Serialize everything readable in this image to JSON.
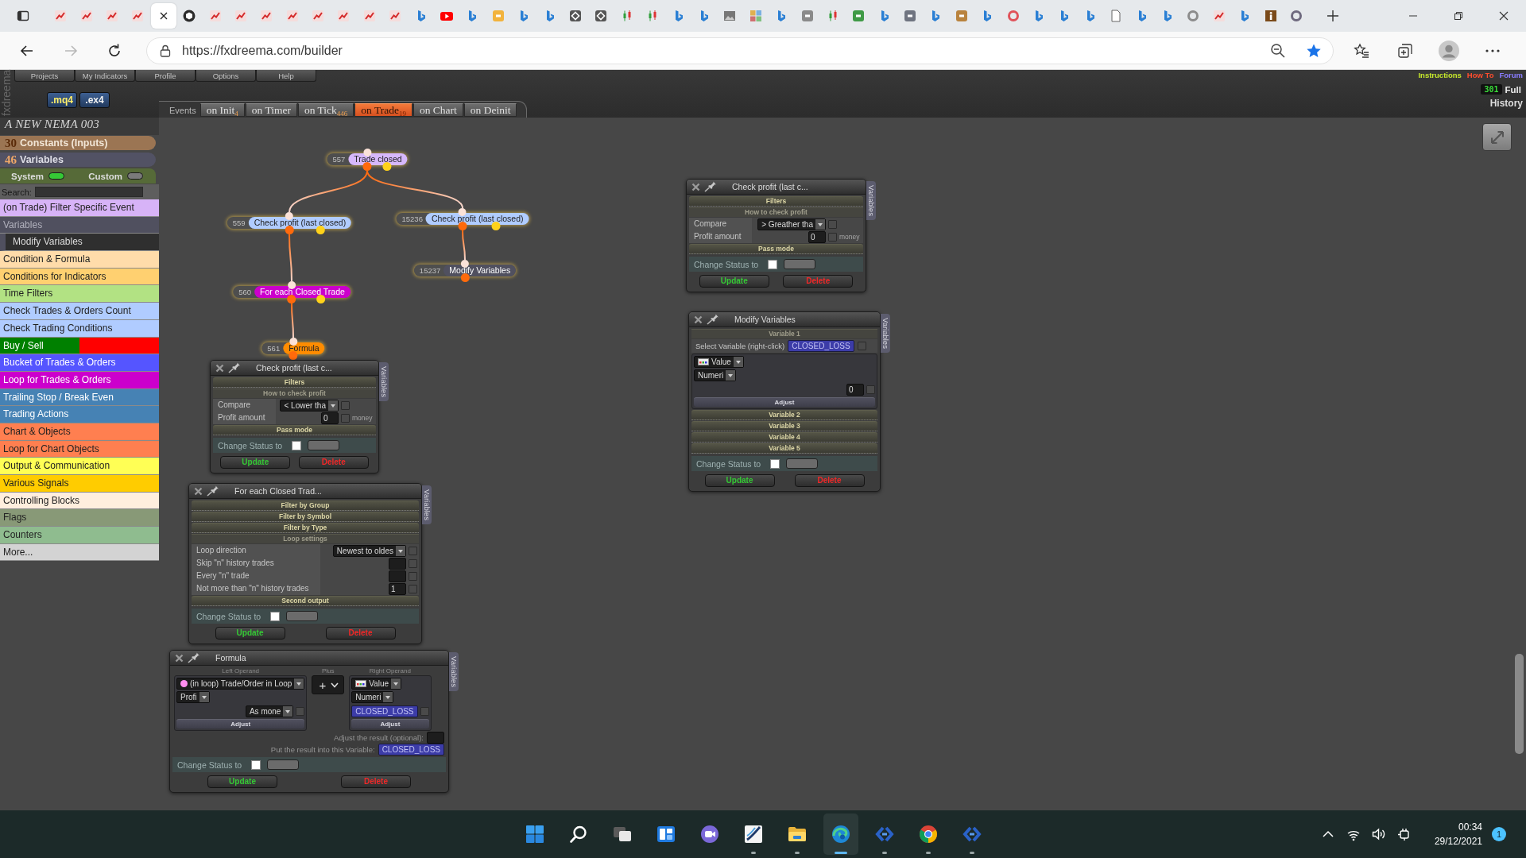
{
  "browser": {
    "tabs": [
      {
        "kind": "pen",
        "selected": false
      },
      {
        "kind": "pen",
        "selected": false
      },
      {
        "kind": "pen",
        "selected": false
      },
      {
        "kind": "pen",
        "selected": false
      },
      {
        "selected": true
      },
      {
        "kind": "hexagon",
        "selected": false
      },
      {
        "kind": "pen",
        "selected": false
      },
      {
        "kind": "pen",
        "selected": false
      },
      {
        "kind": "pen",
        "selected": false
      },
      {
        "kind": "pen",
        "selected": false
      },
      {
        "kind": "pen",
        "selected": false
      },
      {
        "kind": "pen",
        "selected": false
      },
      {
        "kind": "pen",
        "selected": false
      },
      {
        "kind": "pen",
        "selected": false
      },
      {
        "kind": "ribbon",
        "selected": false
      },
      {
        "kind": "play",
        "selected": false
      },
      {
        "kind": "ribbon",
        "selected": false
      },
      {
        "kind": "square",
        "color": "#f2b33d",
        "selected": false
      },
      {
        "kind": "ribbon",
        "selected": false
      },
      {
        "kind": "ribbon",
        "selected": false
      },
      {
        "kind": "diamond",
        "selected": false
      },
      {
        "kind": "diamond",
        "selected": false
      },
      {
        "kind": "candles",
        "selected": false
      },
      {
        "kind": "candles",
        "selected": false
      },
      {
        "kind": "ribbon",
        "selected": false
      },
      {
        "kind": "ribbon",
        "selected": false
      },
      {
        "kind": "picture",
        "selected": false
      },
      {
        "kind": "mosaic",
        "selected": false
      },
      {
        "kind": "ribbon",
        "selected": false
      },
      {
        "kind": "square",
        "color": "#8a8a8a",
        "selected": false
      },
      {
        "kind": "candles",
        "selected": false
      },
      {
        "kind": "square",
        "color": "#3f9a46",
        "selected": false
      },
      {
        "kind": "ribbon",
        "selected": false
      },
      {
        "kind": "square",
        "color": "#6f7480",
        "selected": false
      },
      {
        "kind": "ribbon",
        "selected": false
      },
      {
        "kind": "square",
        "color": "#b9833e",
        "selected": false
      },
      {
        "kind": "ribbon",
        "selected": false
      },
      {
        "kind": "ring",
        "color": "#e0525a",
        "selected": false
      },
      {
        "kind": "ribbon",
        "selected": false
      },
      {
        "kind": "ribbon",
        "selected": false
      },
      {
        "kind": "ribbon",
        "selected": false
      },
      {
        "kind": "page",
        "selected": false
      },
      {
        "kind": "ribbon",
        "selected": false
      },
      {
        "kind": "ribbon",
        "selected": false
      },
      {
        "kind": "ring",
        "color": "#8c8c8c",
        "selected": false
      },
      {
        "kind": "pen",
        "selected": false
      },
      {
        "kind": "ribbon",
        "selected": false
      },
      {
        "kind": "info",
        "selected": false
      },
      {
        "kind": "ring",
        "color": "#6f6a7f",
        "selected": false
      }
    ],
    "nav": [
      {
        "kind": "back",
        "disabled": false
      },
      {
        "kind": "forward",
        "disabled": true
      },
      {
        "kind": "refresh",
        "disabled": false
      }
    ],
    "address": {
      "url": "https://fxdreema.com/builder",
      "bookmarked": true
    }
  },
  "app": {
    "side_label": "fxdreema",
    "menu": [
      "Projects",
      "My Indicators",
      "Profile",
      "Options",
      "Help"
    ],
    "exports": [
      {
        "label": ".mq4",
        "selected": true
      },
      {
        "label": ".ex4",
        "selected": false
      }
    ],
    "links": [
      {
        "label": "Instructions",
        "color": "#c6e82c"
      },
      {
        "label": "How To",
        "color": "#ff4d2e"
      },
      {
        "label": "Forum",
        "color": "#8a7dff"
      }
    ],
    "counter": "301",
    "full": "Full",
    "history": "History"
  },
  "events": {
    "label": "Events",
    "tabs": [
      {
        "label": "on Init$_{4}$",
        "selected": false
      },
      {
        "label": "on Timer",
        "selected": false
      },
      {
        "label": "on Tick$_{446}$",
        "selected": false
      },
      {
        "label": "on Trade$_{19}$",
        "selected": true
      },
      {
        "label": "on Chart",
        "selected": false
      },
      {
        "label": "on Deinit",
        "selected": false
      }
    ]
  },
  "sidebar": {
    "project": "A NEW NEMA 003",
    "constants": {
      "count": "30",
      "label": "Constants (Inputs)"
    },
    "variables": {
      "count": "46",
      "label": "Variables"
    },
    "toggles": [
      {
        "label": "System",
        "on": true
      },
      {
        "label": "Custom",
        "on": false
      }
    ],
    "search_label": "Search:",
    "categories": [
      {
        "kind": "item",
        "label": "(on Trade) Filter Specific Event",
        "color": "#d7b3f7"
      },
      {
        "kind": "header",
        "label": "Variables"
      },
      {
        "kind": "subitem",
        "label": "Modify Variables"
      },
      {
        "kind": "item",
        "label": "Condition & Formula",
        "color": "#ffdcaa"
      },
      {
        "kind": "item",
        "label": "Conditions for Indicators",
        "color": "#ffd070"
      },
      {
        "kind": "item",
        "label": "Time Filters",
        "color": "#b2e283"
      },
      {
        "kind": "item",
        "label": "Check Trades & Orders Count",
        "color": "#b0ccff"
      },
      {
        "kind": "item",
        "label": "Check Trading Conditions",
        "color": "#b0ccff"
      },
      {
        "kind": "split",
        "label": "Buy / Sell",
        "color": "#008000",
        "bands": [
          {
            "color": "#ff0000"
          }
        ]
      },
      {
        "kind": "item",
        "label": "Bucket of Trades & Orders",
        "color": "#5555ff"
      },
      {
        "kind": "item",
        "label": "Loop for Trades & Orders",
        "color": "#cc00cc"
      },
      {
        "kind": "item",
        "label": "Trailing Stop / Break Even",
        "color": "#4682b4"
      },
      {
        "kind": "item",
        "label": "Trading Actions",
        "color": "#4682b4"
      },
      {
        "kind": "item",
        "label": "Chart & Objects",
        "color": "#ff7f50"
      },
      {
        "kind": "item",
        "label": "Loop for Chart Objects",
        "color": "#ff7f50"
      },
      {
        "kind": "item",
        "label": "Output & Communication",
        "color": "#ffff55"
      },
      {
        "kind": "item",
        "label": "Various Signals",
        "color": "#ffcc00"
      },
      {
        "kind": "item",
        "label": "Controlling Blocks",
        "color": "#ffeedd"
      },
      {
        "kind": "item",
        "label": "Flags",
        "color": "#889977"
      },
      {
        "kind": "item",
        "label": "Counters",
        "color": "#8fbc8f"
      },
      {
        "kind": "item",
        "label": "More...",
        "color": "#d3d3d3"
      }
    ]
  },
  "canvas": {
    "nodes": [
      {
        "number": "557",
        "label": "Trade closed",
        "color": "#d6b8fb",
        "second_output": true,
        "children": [
          {
            "number": "559",
            "label": "Check profit (last closed)",
            "color": "#b0ccff",
            "second_output": true,
            "children": [
              {
                "number": "560",
                "label": "For each Closed Trade",
                "color": "#cc00cc",
                "second_output": true,
                "children": [
                  {
                    "number": "561",
                    "label": "Formula",
                    "color": "#ff8c00",
                    "second_output": false
                  }
                ]
              }
            ]
          },
          {
            "number": "15236",
            "label": "Check profit (last closed)",
            "color": "#b0ccff",
            "second_output": true,
            "children": [
              {
                "number": "15237",
                "label": "Modify Variables",
                "color": "#50505f",
                "second_output": false
              }
            ]
          }
        ]
      }
    ],
    "panels": [
      {
        "title": "Check profit (last c...",
        "side_tab": "Variables",
        "rows": [
          {
            "kind": "section",
            "label": "Filters"
          },
          {
            "kind": "subsection",
            "label": "How to check profit"
          },
          {
            "kind": "select",
            "label": "Compare",
            "value": "< Lower tha",
            "checked": false
          },
          {
            "kind": "input",
            "label": "Profit amount",
            "value": "0",
            "checked": false,
            "unit": "money"
          },
          {
            "kind": "section",
            "label": "Pass mode"
          }
        ],
        "status": {
          "label": "Change Status to",
          "checked": false
        },
        "buttons": [
          {
            "kind": "update",
            "label": "Update"
          },
          {
            "kind": "delete",
            "label": "Delete"
          }
        ]
      },
      {
        "title": "For each Closed Trad...",
        "side_tab": "Variables",
        "rows": [
          {
            "kind": "section",
            "label": "Filter by Group"
          },
          {
            "kind": "section",
            "label": "Filter by Symbol"
          },
          {
            "kind": "section",
            "label": "Filter by Type"
          },
          {
            "kind": "subsection",
            "label": "Loop settings"
          },
          {
            "kind": "select",
            "label": "Loop direction",
            "value": "Newest to oldes",
            "checked": false
          },
          {
            "kind": "input",
            "label": "Skip \"n\" history trades",
            "checked": false
          },
          {
            "kind": "input",
            "label": "Every \"n\" trade",
            "checked": false
          },
          {
            "kind": "input",
            "label": "Not more than \"n\" history trades",
            "value": "1",
            "checked": false
          },
          {
            "kind": "section",
            "label": "Second output"
          }
        ],
        "status": {
          "label": "Change Status to",
          "checked": false
        },
        "buttons": [
          {
            "kind": "update",
            "label": "Update"
          },
          {
            "kind": "delete",
            "label": "Delete"
          }
        ]
      },
      {
        "title": "Formula",
        "side_tab": "Variables",
        "rows": [
          {
            "kind": "formula",
            "left": {
              "header": "Left Operand",
              "source": "(in loop) Trade/Order in Loop",
              "field": "Profi",
              "mode": "As mone",
              "checked": false,
              "adjust": "Adjust"
            },
            "operator": {
              "header": "Plus",
              "symbol": "+"
            },
            "right": {
              "header": "Right Operand",
              "type": "Value",
              "field": "Numeri",
              "variable": "CLOSED_LOSS",
              "checked": false,
              "adjust": "Adjust"
            }
          },
          {
            "kind": "result",
            "label": "Adjust the result (optional):"
          },
          {
            "kind": "target",
            "label": "Put the result into this Variable:",
            "variable": "CLOSED_LOSS"
          }
        ],
        "status": {
          "label": "Change Status to",
          "checked": false
        },
        "buttons": [
          {
            "kind": "update",
            "label": "Update"
          },
          {
            "kind": "delete",
            "label": "Delete"
          }
        ]
      },
      {
        "title": "Check profit (last c...",
        "side_tab": "Variables",
        "rows": [
          {
            "kind": "section",
            "label": "Filters"
          },
          {
            "kind": "subsection",
            "label": "How to check profit"
          },
          {
            "kind": "select",
            "label": "Compare",
            "value": "> Greather tha",
            "checked": false
          },
          {
            "kind": "input",
            "label": "Profit amount",
            "value": "0",
            "checked": false,
            "unit": "money"
          },
          {
            "kind": "section",
            "label": "Pass mode"
          }
        ],
        "status": {
          "label": "Change Status to",
          "checked": false
        },
        "buttons": [
          {
            "kind": "update",
            "label": "Update"
          },
          {
            "kind": "delete",
            "label": "Delete"
          }
        ]
      },
      {
        "title": "Modify Variables",
        "side_tab": "Variables",
        "rows": [
          {
            "kind": "subsection",
            "label": "Variable 1"
          },
          {
            "kind": "variable",
            "label": "Select Variable (right-click)",
            "variable": "CLOSED_LOSS",
            "checked": false
          },
          {
            "kind": "operand",
            "type": "Value",
            "field": "Numeri",
            "value": "0",
            "checked": false,
            "adjust": "Adjust"
          },
          {
            "kind": "section",
            "label": "Variable 2"
          },
          {
            "kind": "section",
            "label": "Variable 3"
          },
          {
            "kind": "section",
            "label": "Variable 4"
          },
          {
            "kind": "section",
            "label": "Variable 5"
          }
        ],
        "status": {
          "label": "Change Status to",
          "checked": false
        },
        "buttons": [
          {
            "kind": "update",
            "label": "Update"
          },
          {
            "kind": "delete",
            "label": "Delete"
          }
        ]
      }
    ]
  },
  "taskbar": {
    "apps": [
      {
        "kind": "start",
        "running": false,
        "active": false
      },
      {
        "kind": "search",
        "running": false,
        "active": false
      },
      {
        "kind": "taskview",
        "running": false,
        "active": false
      },
      {
        "kind": "widgets",
        "running": false,
        "active": false
      },
      {
        "kind": "chat",
        "running": false,
        "active": false
      },
      {
        "kind": "swoosh",
        "running": true,
        "active": false
      },
      {
        "kind": "files",
        "running": true,
        "active": false
      },
      {
        "kind": "edge",
        "running": true,
        "active": true
      },
      {
        "kind": "code",
        "running": true,
        "active": false
      },
      {
        "kind": "chrome",
        "running": true,
        "active": false
      },
      {
        "kind": "code",
        "running": true,
        "active": false
      }
    ],
    "time": "00:34",
    "date": "29/12/2021",
    "notifications": "1"
  }
}
